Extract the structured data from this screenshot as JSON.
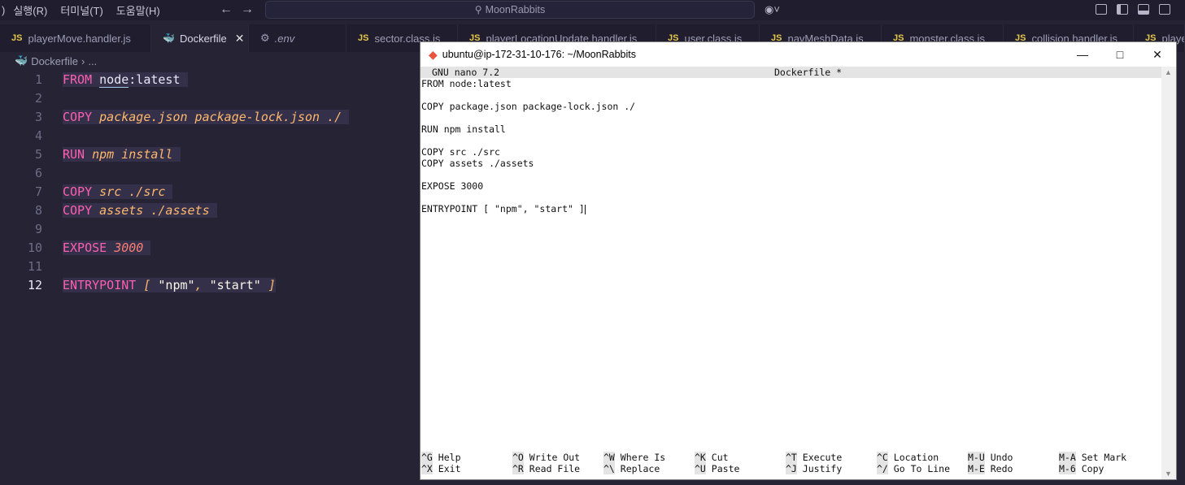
{
  "menu": [
    "실행(R)",
    "터미널(T)",
    "도움말(H)"
  ],
  "menu_prefix": ")",
  "search": {
    "text": "MoonRabbits"
  },
  "tabs": [
    {
      "label": "playerMove.handler.js",
      "type": "js"
    },
    {
      "label": "Dockerfile",
      "type": "docker",
      "active": true
    },
    {
      "label": ".env",
      "type": "env"
    },
    {
      "label": "sector.class.js",
      "type": "js"
    },
    {
      "label": "playerLocationUpdate.handler.js",
      "type": "js"
    },
    {
      "label": "user.class.js",
      "type": "js"
    },
    {
      "label": "navMeshData.js",
      "type": "js"
    },
    {
      "label": "monster.class.js",
      "type": "js"
    },
    {
      "label": "collision.handler.js",
      "type": "js"
    },
    {
      "label": "playe",
      "type": "js"
    }
  ],
  "breadcrumb": {
    "file": "Dockerfile",
    "rest": "..."
  },
  "editor": {
    "lines": [
      "1",
      "2",
      "3",
      "4",
      "5",
      "6",
      "7",
      "8",
      "9",
      "10",
      "11",
      "12"
    ],
    "code": {
      "l1_kw": "FROM",
      "l1_node": "node",
      "l1_rest": ":latest",
      "l3_kw": "COPY",
      "l3_arg": "package.json package-lock.json ./",
      "l5_kw": "RUN",
      "l5_arg": "npm install",
      "l7_kw": "COPY",
      "l7_arg": "src ./src",
      "l8_kw": "COPY",
      "l8_arg": "assets ./assets",
      "l10_kw": "EXPOSE",
      "l10_arg": "3000",
      "l12_kw": "ENTRYPOINT",
      "l12_b1": "[",
      "l12_s1": "\"npm\"",
      "l12_c": ",",
      "l12_s2": "\"start\"",
      "l12_b2": "]"
    }
  },
  "terminal": {
    "title": "ubuntu@ip-172-31-10-176: ~/MoonRabbits",
    "nano_version": "GNU nano 7.2",
    "nano_file": "Dockerfile *",
    "lines": [
      "FROM node:latest",
      "",
      "COPY package.json package-lock.json ./",
      "",
      "RUN npm install",
      "",
      "COPY src ./src",
      "COPY assets ./assets",
      "",
      "EXPOSE 3000",
      "",
      "ENTRYPOINT [ \"npm\", \"start\" ]"
    ],
    "shortcuts_row1": [
      {
        "key": "^G",
        "label": "Help"
      },
      {
        "key": "^O",
        "label": "Write Out"
      },
      {
        "key": "^W",
        "label": "Where Is"
      },
      {
        "key": "^K",
        "label": "Cut"
      },
      {
        "key": "^T",
        "label": "Execute"
      },
      {
        "key": "^C",
        "label": "Location"
      },
      {
        "key": "M-U",
        "label": "Undo"
      },
      {
        "key": "M-A",
        "label": "Set Mark"
      }
    ],
    "shortcuts_row2": [
      {
        "key": "^X",
        "label": "Exit"
      },
      {
        "key": "^R",
        "label": "Read File"
      },
      {
        "key": "^\\",
        "label": "Replace"
      },
      {
        "key": "^U",
        "label": "Paste"
      },
      {
        "key": "^J",
        "label": "Justify"
      },
      {
        "key": "^/",
        "label": "Go To Line"
      },
      {
        "key": "M-E",
        "label": "Redo"
      },
      {
        "key": "M-6",
        "label": "Copy"
      }
    ]
  }
}
